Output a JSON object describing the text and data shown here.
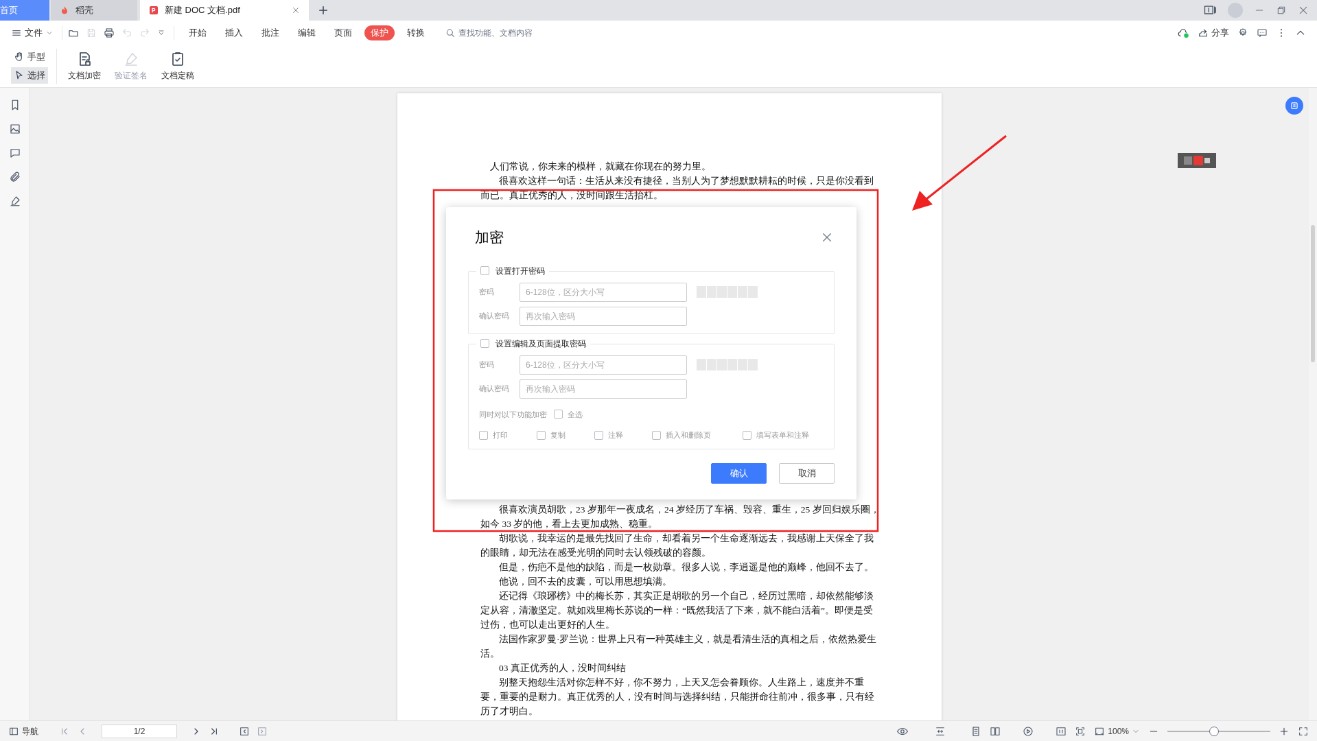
{
  "tabs": [
    {
      "kind": "home",
      "label": "首页",
      "selected": false
    },
    {
      "kind": "app",
      "label": "稻壳",
      "selected": false
    },
    {
      "kind": "document",
      "label": "新建 DOC 文档.pdf",
      "selected": true
    }
  ],
  "toolbar": {
    "file_menu": "文件",
    "menu_tabs": [
      {
        "label": "开始",
        "selected": false
      },
      {
        "label": "插入",
        "selected": false
      },
      {
        "label": "批注",
        "selected": false
      },
      {
        "label": "编辑",
        "selected": false
      },
      {
        "label": "页面",
        "selected": false
      },
      {
        "label": "保护",
        "selected": true
      },
      {
        "label": "转换",
        "selected": false
      }
    ],
    "search": {
      "placeholder": "查找功能、文档内容"
    },
    "share": "分享"
  },
  "ribbon": {
    "tools": [
      {
        "label": "手型",
        "selected": false
      },
      {
        "label": "选择",
        "selected": true
      }
    ],
    "buttons": [
      {
        "kind": "encrypt",
        "label": "文档加密",
        "disabled": false
      },
      {
        "kind": "signature",
        "label": "验证签名",
        "disabled": true
      },
      {
        "kind": "finalize",
        "label": "文档定稿",
        "disabled": false
      }
    ]
  },
  "document": {
    "paragraphs_top": [
      {
        "kind": "lead",
        "text": "人们常说，你未来的模样，就藏在你现在的努力里。"
      },
      {
        "kind": "body",
        "text": "很喜欢这样一句话：生活从来没有捷径，当别人为了梦想默默耕耘的时候，只是你没看到而已。真正优秀的人，没时间跟生活抬杠。"
      }
    ],
    "paragraphs_bottom": [
      {
        "kind": "body",
        "text": "很喜欢演员胡歌，23 岁那年一夜成名，24 岁经历了车祸、毁容、重生，25 岁回归娱乐圈，如今 33 岁的他，看上去更加成熟、稳重。"
      },
      {
        "kind": "body",
        "text": "胡歌说，我幸运的是最先找回了生命，却看着另一个生命逐渐远去，我感谢上天保全了我的眼睛，却无法在感受光明的同时去认领残破的容颜。"
      },
      {
        "kind": "body",
        "text": "但是，伤疤不是他的缺陷，而是一枚勋章。很多人说，李逍遥是他的巅峰，他回不去了。"
      },
      {
        "kind": "body",
        "text": "他说，回不去的皮囊，可以用思想填满。"
      },
      {
        "kind": "body",
        "text": "还记得《琅琊榜》中的梅长苏，其实正是胡歌的另一个自己，经历过黑暗，却依然能够淡定从容，清澈坚定。就如戏里梅长苏说的一样：“既然我活了下来，就不能白活着”。即便是受过伤，也可以走出更好的人生。"
      },
      {
        "kind": "body",
        "text": "法国作家罗曼·罗兰说：世界上只有一种英雄主义，就是看清生活的真相之后，依然热爱生活。"
      },
      {
        "kind": "body",
        "text": "03 真正优秀的人，没时间纠结"
      },
      {
        "kind": "body",
        "text": "别整天抱怨生活对你怎样不好，你不努力，上天又怎会眷顾你。人生路上，速度并不重要，重要的是耐力。真正优秀的人，没有时间与选择纠结，只能拼命往前冲，很多事，只有经历了才明白。"
      }
    ]
  },
  "dialog": {
    "title": "加密",
    "sections": [
      {
        "label": "设置打开密码",
        "checked": false,
        "fields": [
          {
            "label": "密码",
            "placeholder": "6-128位，区分大小写",
            "kind": "password"
          },
          {
            "label": "确认密码",
            "placeholder": "再次输入密码",
            "kind": "confirm"
          }
        ]
      },
      {
        "label": "设置编辑及页面提取密码",
        "checked": false,
        "fields": [
          {
            "label": "密码",
            "placeholder": "6-128位，区分大小写",
            "kind": "password"
          },
          {
            "label": "确认密码",
            "placeholder": "再次输入密码",
            "kind": "confirm"
          }
        ],
        "also_encrypt": {
          "label": "同时对以下功能加密",
          "select_all": {
            "label": "全选",
            "checked": false
          },
          "options": [
            {
              "label": "打印",
              "checked": false
            },
            {
              "label": "复制",
              "checked": false
            },
            {
              "label": "注释",
              "checked": false
            },
            {
              "label": "插入和删除页",
              "checked": false
            },
            {
              "label": "填写表单和注释",
              "checked": false
            }
          ]
        }
      }
    ],
    "buttons": [
      {
        "kind": "primary",
        "label": "确认"
      },
      {
        "kind": "secondary",
        "label": "取消"
      }
    ]
  },
  "status_bar": {
    "nav": "导航",
    "page": "1/2",
    "zoom": "100%",
    "zoom_slider": {
      "level": 0.45
    }
  }
}
